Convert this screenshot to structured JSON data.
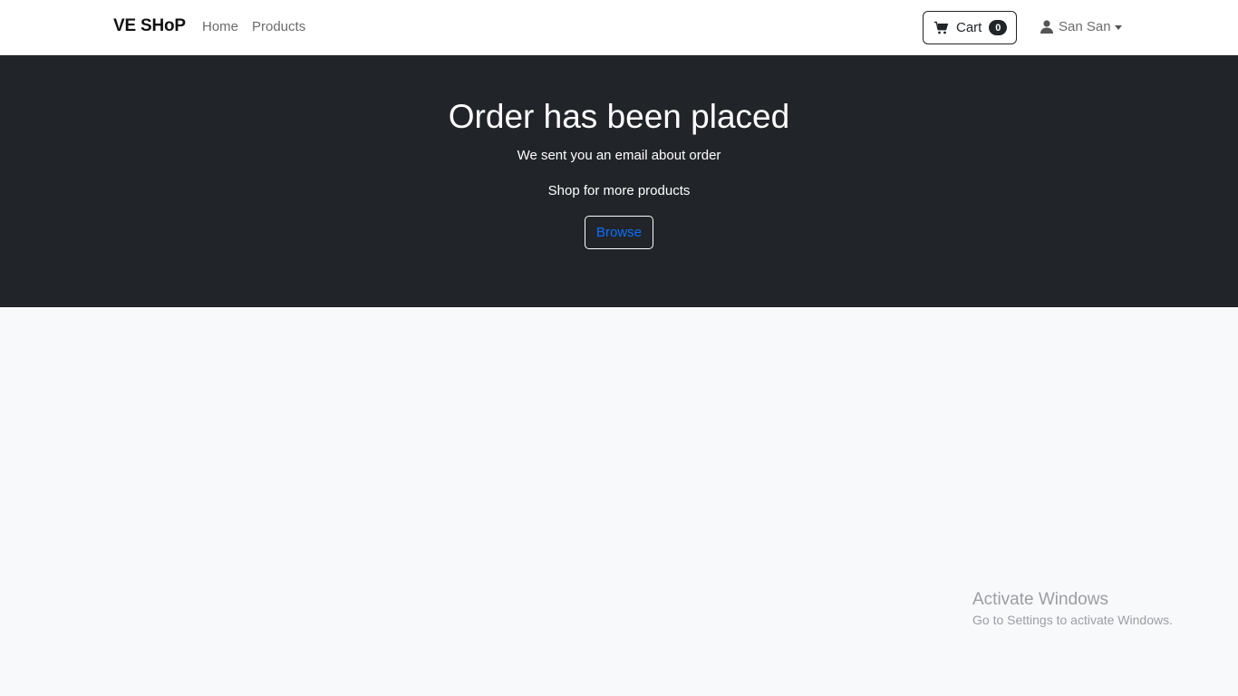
{
  "navbar": {
    "brand": "VE SHoP",
    "links": [
      {
        "label": "Home"
      },
      {
        "label": "Products"
      }
    ],
    "cart": {
      "label": "Cart",
      "count": "0",
      "icon": "cart-icon"
    },
    "user": {
      "name": "San San",
      "icon": "user-icon"
    }
  },
  "hero": {
    "title": "Order has been placed",
    "subtitle": "We sent you an email about order",
    "more_text": "Shop for more products",
    "browse_label": "Browse"
  },
  "watermark": {
    "title": "Activate Windows",
    "subtitle": "Go to Settings to activate Windows."
  },
  "colors": {
    "hero_bg": "#212529",
    "page_bg": "#f8f9fa",
    "link_blue": "#0d6efd"
  }
}
